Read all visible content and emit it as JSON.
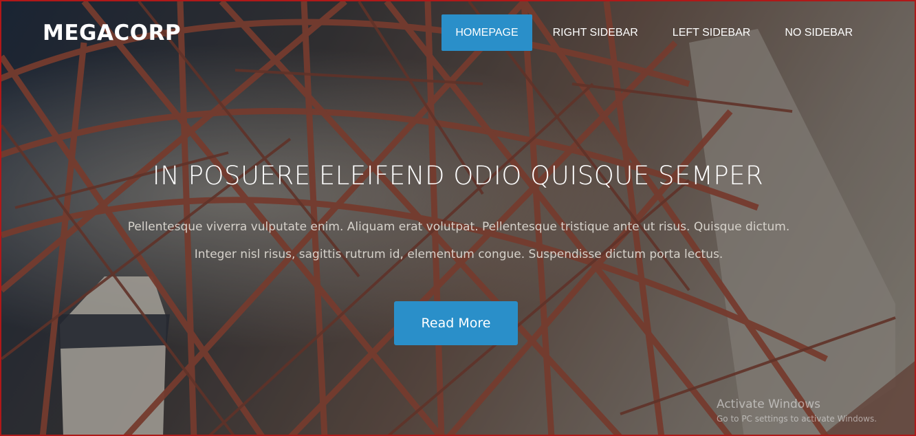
{
  "brand": {
    "name": "MEGACORP"
  },
  "nav": {
    "items": [
      {
        "label": "HOMEPAGE",
        "active": true
      },
      {
        "label": "RIGHT SIDEBAR",
        "active": false
      },
      {
        "label": "LEFT SIDEBAR",
        "active": false
      },
      {
        "label": "NO SIDEBAR",
        "active": false
      }
    ]
  },
  "hero": {
    "title": "IN POSUERE ELEIFEND ODIO QUISQUE SEMPER",
    "text": "Pellentesque viverra vulputate enim. Aliquam erat volutpat. Pellentesque tristique ante ut risus. Quisque dictum. Integer nisl risus, sagittis rutrum id, elementum congue. Suspendisse dictum porta lectus.",
    "button": "Read More"
  },
  "watermark": {
    "title": "Activate Windows",
    "subtitle": "Go to PC settings to activate Windows."
  },
  "colors": {
    "accent": "#2a8fc9",
    "frame_border": "#b01818",
    "beam": "#9a4a35"
  }
}
